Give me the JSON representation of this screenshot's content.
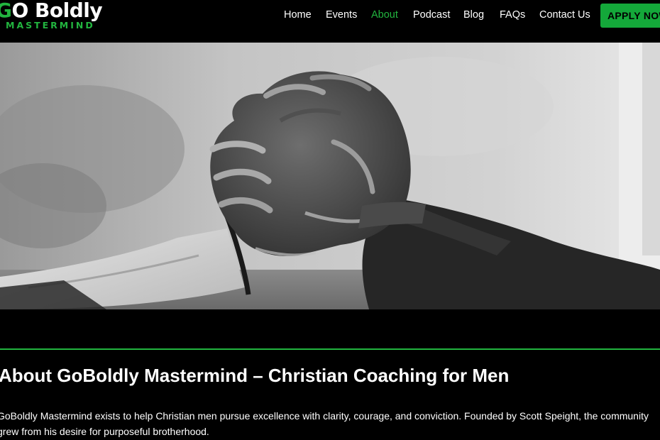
{
  "brand": {
    "logo_mark": "G",
    "logo_word": "O Boldly",
    "logo_sub": "MASTERMIND"
  },
  "nav": {
    "items": [
      {
        "label": "Home"
      },
      {
        "label": "Events"
      },
      {
        "label": "About",
        "active": true
      },
      {
        "label": "Podcast"
      },
      {
        "label": "Blog"
      },
      {
        "label": "FAQs"
      },
      {
        "label": "Contact Us"
      }
    ],
    "cta_label": "APPLY NOW"
  },
  "hero": {
    "image": "arm-wrestling-hands-photo"
  },
  "main": {
    "title": "About GoBoldly Mastermind – Christian Coaching for Men",
    "intro": "GoBoldly Mastermind exists to help Christian men pursue excellence with clarity, courage, and conviction. Founded by Scott Speight, the community grew from his desire for purposeful brotherhood."
  },
  "colors": {
    "accent": "#22b53f",
    "button": "#14a83a",
    "background": "#000000",
    "text": "#ffffff"
  }
}
